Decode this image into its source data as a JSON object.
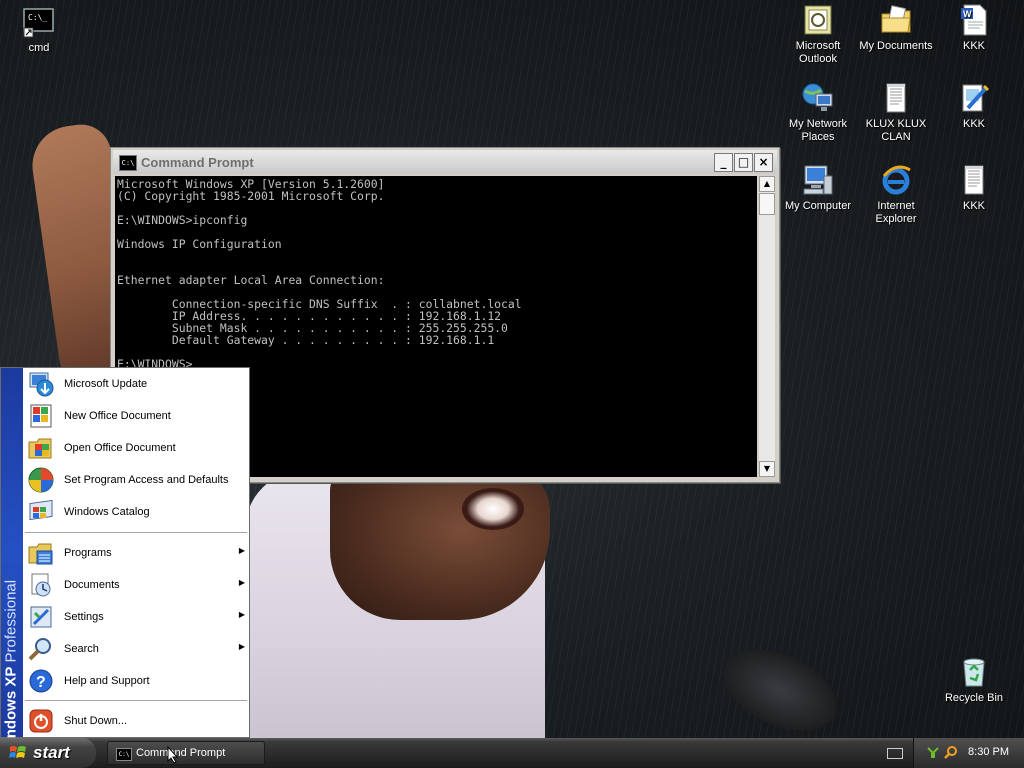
{
  "desktop": {
    "icons": [
      {
        "label": "cmd"
      },
      {
        "label": "Microsoft Outlook"
      },
      {
        "label": "My Documents"
      },
      {
        "label": "KKK"
      },
      {
        "label": "My Network Places"
      },
      {
        "label": "KLUX KLUX CLAN"
      },
      {
        "label": "KKK"
      },
      {
        "label": "My Computer"
      },
      {
        "label": "Internet Explorer"
      },
      {
        "label": "KKK"
      },
      {
        "label": "Recycle Bin"
      }
    ]
  },
  "cmd_window": {
    "title": "Command Prompt",
    "icon_text": "C:\\",
    "minimize": "_",
    "maximize": "□",
    "close": "×",
    "output": "Microsoft Windows XP [Version 5.1.2600]\n(C) Copyright 1985-2001 Microsoft Corp.\n\nE:\\WINDOWS>ipconfig\n\nWindows IP Configuration\n\n\nEthernet adapter Local Area Connection:\n\n        Connection-specific DNS Suffix  . : collabnet.local\n        IP Address. . . . . . . . . . . . : 192.168.1.12\n        Subnet Mask . . . . . . . . . . . : 255.255.255.0\n        Default Gateway . . . . . . . . . : 192.168.1.1\n\nE:\\WINDOWS>"
  },
  "start_menu": {
    "band_os": "Windows XP",
    "band_edition": "Professional",
    "items_top": [
      {
        "label": "Microsoft Update"
      },
      {
        "label": "New Office Document"
      },
      {
        "label": "Open Office Document"
      },
      {
        "label": "Set Program Access and Defaults"
      },
      {
        "label": "Windows Catalog"
      }
    ],
    "items_mid": [
      {
        "label": "Programs",
        "submenu": true
      },
      {
        "label": "Documents",
        "submenu": true
      },
      {
        "label": "Settings",
        "submenu": true
      },
      {
        "label": "Search",
        "submenu": true
      },
      {
        "label": "Help and Support",
        "submenu": false
      }
    ],
    "items_bottom": [
      {
        "label": "Shut Down..."
      }
    ],
    "arrow": "▶"
  },
  "taskbar": {
    "start_label": "start",
    "task_button_label": "Command Prompt",
    "clock": "8:30 PM"
  }
}
